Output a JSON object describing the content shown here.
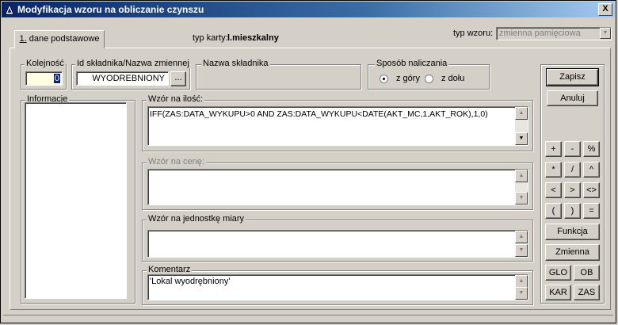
{
  "window": {
    "title": "Modyfikacja wzoru na obliczanie czynszu",
    "close_label": "X"
  },
  "tab": {
    "label_num": "1.",
    "label_rest": " dane podstawowe"
  },
  "header": {
    "typ_karty_label": "typ karty:",
    "typ_karty_value": "l.mieszkalny",
    "typ_wzoru_label": "typ wzoru:",
    "typ_wzoru_value": "zmienna pamięciowa"
  },
  "kolejnosc": {
    "label": "Kolejność",
    "value": "0"
  },
  "id_skladnika": {
    "label": "Id składnika/Nazwa zmiennej",
    "value": "WYODREBNIONY",
    "browse_label": "..."
  },
  "nazwa_skladnika": {
    "label": "Nazwa składnika"
  },
  "sposob": {
    "label": "Sposób naliczania",
    "opt1": "z góry",
    "opt2": "z dołu",
    "selected": "z góry"
  },
  "informacje": {
    "label": "Informacje"
  },
  "wzor_ilosc": {
    "label": "Wzór na ilość:",
    "value": "IFF(ZAS:DATA_WYKUPU>0 AND ZAS:DATA_WYKUPU<DATE(AKT_MC,1,AKT_ROK),1,0)"
  },
  "wzor_cene": {
    "label": "Wzór na cenę:",
    "value": ""
  },
  "wzor_jm": {
    "label": "Wzór na jednostkę miary",
    "value": ""
  },
  "komentarz": {
    "label": "Komentarz",
    "value": "'Lokal wyodrębniony'"
  },
  "buttons": {
    "zapisz": "Zapisz",
    "anuluj": "Anuluj",
    "ops": [
      "+",
      "-",
      "%",
      "*",
      "/",
      "^",
      "<",
      ">",
      "<>",
      "(",
      ")",
      "="
    ],
    "funkcja": "Funkcja",
    "zmienna": "Zmienna",
    "glo": "GLO",
    "ob": "OB",
    "kar": "KAR",
    "zas": "ZAS"
  },
  "icons": {
    "up": "scroll-up-icon",
    "down": "scroll-down-icon",
    "app": "app-triangle-icon"
  }
}
